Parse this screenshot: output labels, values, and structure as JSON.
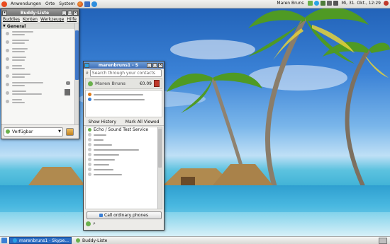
{
  "top_panel": {
    "menu_apps": "Anwendungen",
    "menu_places": "Orte",
    "menu_system": "System",
    "user_name": "Maren Bruns",
    "clock": "Mi, 31. Okt., 12:29"
  },
  "bottom_panel": {
    "task_skype": "marenbruns1 - Skype...",
    "task_buddylist": "Buddy-Liste"
  },
  "buddy_window": {
    "title": "Buddy-Liste",
    "menu": [
      "Buddies",
      "Konten",
      "Werkzeuge",
      "Hilfe"
    ],
    "group": "General",
    "status": "Verfügbar"
  },
  "skype_window": {
    "title": "marenbruns1 - S",
    "search_placeholder": "Search through your contacts",
    "account_name": "Maren Bruns",
    "balance": "€0.09",
    "show_history": "Show History",
    "mark_all_viewed": "Mark All Viewed",
    "echo_contact": "Echo / Sound Test Service",
    "call_phones": "Call ordinary phones"
  },
  "colors": {
    "titlebar_active": "#3f6fb8",
    "status_green": "#6ab04c",
    "skype_orange": "#e07a16"
  }
}
